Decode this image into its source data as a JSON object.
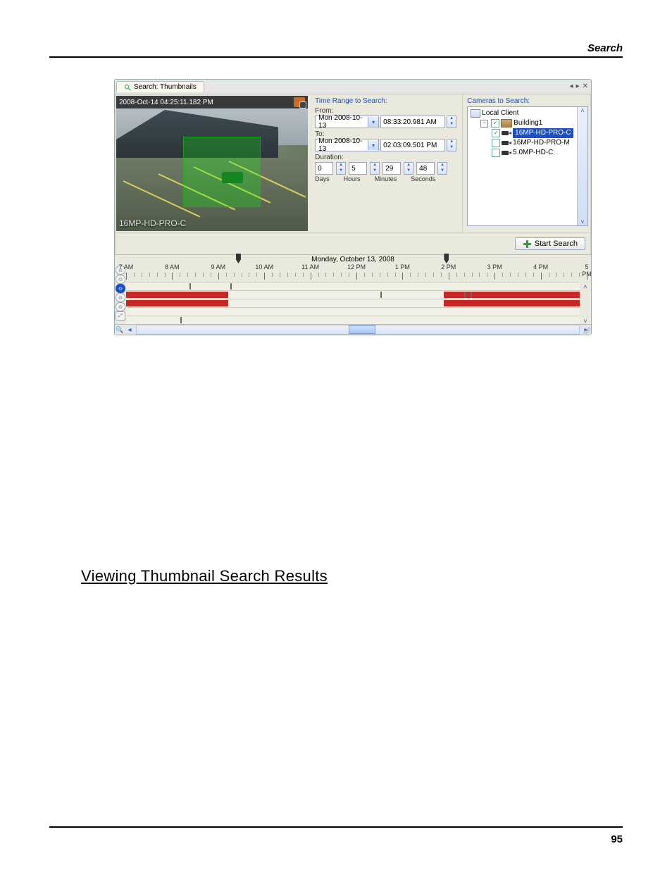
{
  "doc": {
    "header": "Search",
    "page_number": "95",
    "section_heading": "Viewing Thumbnail Search Results"
  },
  "window": {
    "tab_title": "Search: Thumbnails",
    "controls": {
      "prev": "◂",
      "next": "▸",
      "close": "✕"
    }
  },
  "preview": {
    "timestamp": "2008-Oct-14 04:25:11.182 PM",
    "camera_name": "16MP-HD-PRO-C"
  },
  "time_range": {
    "title": "Time Range to Search:",
    "from_label": "From:",
    "from_date": "Mon 2008-10-13",
    "from_time": "08:33:20.981 AM",
    "to_label": "To:",
    "to_date": "Mon 2008-10-13",
    "to_time": "02:03:09.501 PM",
    "duration_label": "Duration:",
    "days": "0",
    "hours": "5",
    "minutes": "29",
    "seconds": "48",
    "u_days": "Days",
    "u_hours": "Hours",
    "u_minutes": "Minutes",
    "u_seconds": "Seconds"
  },
  "cameras": {
    "title": "Cameras to Search:",
    "root": "Local Client",
    "site": "Building1",
    "items": [
      {
        "name": "16MP-HD-PRO-C",
        "checked": true,
        "selected": true
      },
      {
        "name": "16MP-HD-PRO-M",
        "checked": false,
        "selected": false
      },
      {
        "name": "5.0MP-HD-C",
        "checked": false,
        "selected": false
      }
    ]
  },
  "start_search_label": "Start Search",
  "timeline": {
    "date_label": "Monday, October 13, 2008",
    "hours": [
      "7 AM",
      "8 AM",
      "9 AM",
      "10 AM",
      "11 AM",
      "12 PM",
      "1 PM",
      "2 PM",
      "3 PM",
      "4 PM",
      "5 PM"
    ],
    "range": {
      "start_pct": 22.5,
      "end_pct": 70.0
    }
  }
}
